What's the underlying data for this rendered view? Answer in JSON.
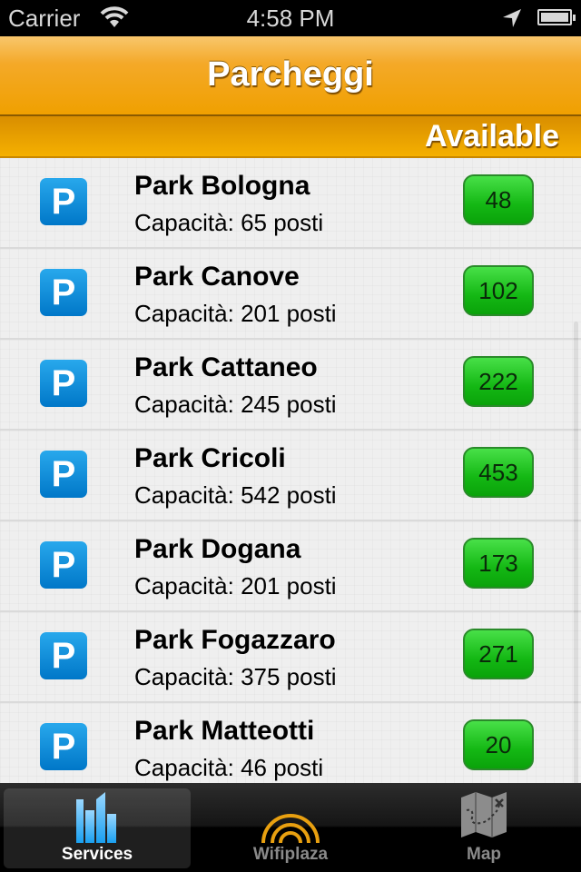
{
  "status_bar": {
    "carrier": "Carrier",
    "time": "4:58 PM"
  },
  "nav": {
    "title": "Parcheggi"
  },
  "subheader": {
    "label": "Available"
  },
  "parkings": [
    {
      "name": "Park Bologna",
      "capacity": "Capacità: 65 posti",
      "available": "48"
    },
    {
      "name": "Park Canove",
      "capacity": "Capacità: 201 posti",
      "available": "102"
    },
    {
      "name": "Park Cattaneo",
      "capacity": "Capacità: 245 posti",
      "available": "222"
    },
    {
      "name": "Park Cricoli",
      "capacity": "Capacità: 542 posti",
      "available": "453"
    },
    {
      "name": "Park Dogana",
      "capacity": "Capacità: 201 posti",
      "available": "173"
    },
    {
      "name": "Park Fogazzaro",
      "capacity": "Capacità: 375 posti",
      "available": "271"
    },
    {
      "name": "Park Matteotti",
      "capacity": "Capacità: 46 posti",
      "available": "20"
    }
  ],
  "parking_icon_letter": "P",
  "tabs": [
    {
      "label": "Services",
      "icon": "buildings-icon",
      "active": true
    },
    {
      "label": "Wifiplaza",
      "icon": "wifi-signal-icon",
      "active": false
    },
    {
      "label": "Map",
      "icon": "map-icon",
      "active": false
    }
  ],
  "colors": {
    "accent": "#f0a000",
    "badge": "#14b814",
    "parking_icon": "#0a8ad8"
  }
}
